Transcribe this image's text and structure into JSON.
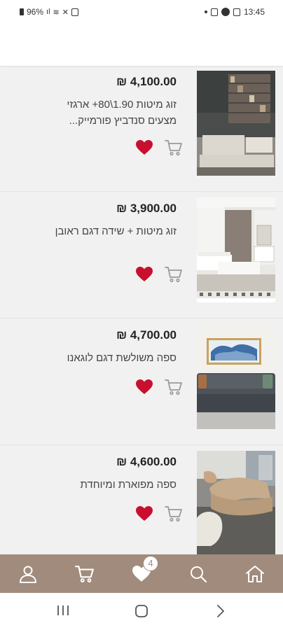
{
  "status_bar": {
    "battery": "96%",
    "time": "13:45"
  },
  "products": [
    {
      "price": "₪ 4,100.00",
      "title": "זוג מיטות 1.90\\80+ ארגזי מצעים סנדביץ פורמייק..."
    },
    {
      "price": "₪ 3,900.00",
      "title": "זוג מיטות + שידה דגם ראובן"
    },
    {
      "price": "₪ 4,700.00",
      "title": "ספה משולשת דגם לוגאנו"
    },
    {
      "price": "₪ 4,600.00",
      "title": "ספה מפוארת ומיוחדת"
    }
  ],
  "bottom_nav": {
    "items": [
      "user-icon",
      "cart-icon",
      "favorites-icon",
      "search-icon",
      "home-icon"
    ],
    "favorites_count": "4"
  },
  "colors": {
    "nav_background": "#a18b7c",
    "heart": "#c8102e",
    "list_background": "#f1f1f1"
  }
}
